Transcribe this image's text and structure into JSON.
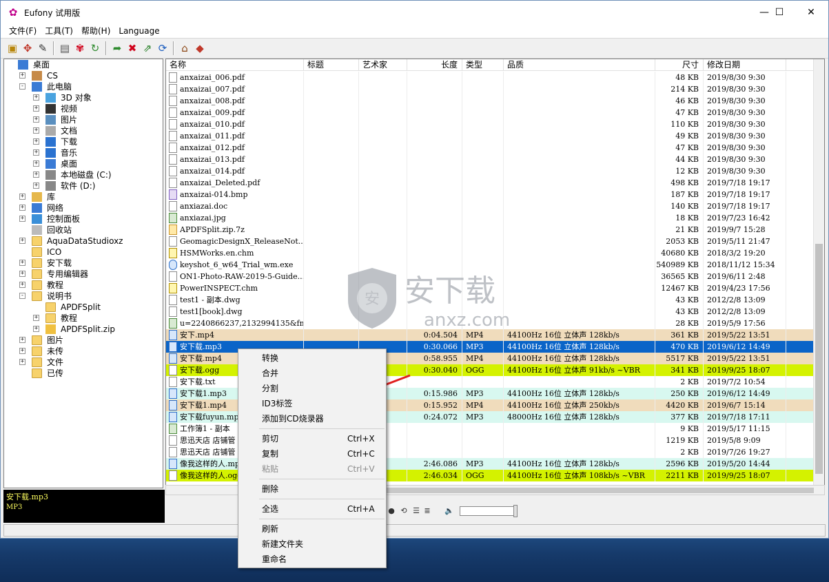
{
  "window": {
    "title": "Eufony 试用版",
    "minimize": "—",
    "maximize": "☐",
    "close": "✕"
  },
  "menu": [
    "文件(F)",
    "工具(T)",
    "帮助(H)",
    "Language"
  ],
  "toolbar_icons": [
    "open-folder-icon",
    "tag-icon",
    "edit-icon",
    "new-doc-icon",
    "flower-icon",
    "refresh-icon",
    "forward-icon",
    "cross-icon",
    "swap-icon",
    "sync-icon",
    "home-icon",
    "book-icon"
  ],
  "tree": [
    {
      "label": "桌面",
      "level": 0,
      "exp": "",
      "icon": "desktop"
    },
    {
      "label": "CS",
      "level": 1,
      "exp": "+",
      "icon": "user"
    },
    {
      "label": "此电脑",
      "level": 1,
      "exp": "-",
      "icon": "computer"
    },
    {
      "label": "3D 对象",
      "level": 2,
      "exp": "+",
      "icon": "3d"
    },
    {
      "label": "视频",
      "level": 2,
      "exp": "+",
      "icon": "video"
    },
    {
      "label": "图片",
      "level": 2,
      "exp": "+",
      "icon": "picture"
    },
    {
      "label": "文档",
      "level": 2,
      "exp": "+",
      "icon": "document"
    },
    {
      "label": "下载",
      "level": 2,
      "exp": "+",
      "icon": "download"
    },
    {
      "label": "音乐",
      "level": 2,
      "exp": "+",
      "icon": "music"
    },
    {
      "label": "桌面",
      "level": 2,
      "exp": "+",
      "icon": "desktop"
    },
    {
      "label": "本地磁盘 (C:)",
      "level": 2,
      "exp": "+",
      "icon": "disk"
    },
    {
      "label": "软件 (D:)",
      "level": 2,
      "exp": "+",
      "icon": "disk"
    },
    {
      "label": "库",
      "level": 1,
      "exp": "+",
      "icon": "library"
    },
    {
      "label": "网络",
      "level": 1,
      "exp": "+",
      "icon": "network"
    },
    {
      "label": "控制面板",
      "level": 1,
      "exp": "+",
      "icon": "control"
    },
    {
      "label": "回收站",
      "level": 1,
      "exp": "",
      "icon": "recycle"
    },
    {
      "label": "AquaDataStudioxz",
      "level": 1,
      "exp": "+",
      "icon": "folder"
    },
    {
      "label": "ICO",
      "level": 1,
      "exp": "",
      "icon": "folder"
    },
    {
      "label": "安下载",
      "level": 1,
      "exp": "+",
      "icon": "folder"
    },
    {
      "label": "专用编辑器",
      "level": 1,
      "exp": "+",
      "icon": "folder"
    },
    {
      "label": "教程",
      "level": 1,
      "exp": "+",
      "icon": "folder"
    },
    {
      "label": "说明书",
      "level": 1,
      "exp": "-",
      "icon": "folder"
    },
    {
      "label": "APDFSplit",
      "level": 2,
      "exp": "",
      "icon": "folder"
    },
    {
      "label": "教程",
      "level": 2,
      "exp": "+",
      "icon": "folder"
    },
    {
      "label": "APDFSplit.zip",
      "level": 2,
      "exp": "+",
      "icon": "zip"
    },
    {
      "label": "图片",
      "level": 1,
      "exp": "+",
      "icon": "folder"
    },
    {
      "label": "未传",
      "level": 1,
      "exp": "+",
      "icon": "folder"
    },
    {
      "label": "文件",
      "level": 1,
      "exp": "+",
      "icon": "folder"
    },
    {
      "label": "已传",
      "level": 1,
      "exp": "",
      "icon": "folder"
    }
  ],
  "columns": [
    "名称",
    "标题",
    "艺术家",
    "长度",
    "类型",
    "品质",
    "尺寸",
    "修改日期"
  ],
  "files": [
    {
      "name": "anxaizai_006.pdf",
      "title": "",
      "artist": "",
      "length": "",
      "type": "",
      "quality": "",
      "size": "48 KB",
      "date": "2019/8/30 9:30",
      "icon": "pdf",
      "bg": "#ffffff",
      "fg": "#000000"
    },
    {
      "name": "anxaizai_007.pdf",
      "title": "",
      "artist": "",
      "length": "",
      "type": "",
      "quality": "",
      "size": "214 KB",
      "date": "2019/8/30 9:30",
      "icon": "pdf",
      "bg": "#ffffff",
      "fg": "#000000"
    },
    {
      "name": "anxaizai_008.pdf",
      "title": "",
      "artist": "",
      "length": "",
      "type": "",
      "quality": "",
      "size": "46 KB",
      "date": "2019/8/30 9:30",
      "icon": "pdf",
      "bg": "#ffffff",
      "fg": "#000000"
    },
    {
      "name": "anxaizai_009.pdf",
      "title": "",
      "artist": "",
      "length": "",
      "type": "",
      "quality": "",
      "size": "47 KB",
      "date": "2019/8/30 9:30",
      "icon": "pdf",
      "bg": "#ffffff",
      "fg": "#000000"
    },
    {
      "name": "anxaizai_010.pdf",
      "title": "",
      "artist": "",
      "length": "",
      "type": "",
      "quality": "",
      "size": "110 KB",
      "date": "2019/8/30 9:30",
      "icon": "pdf",
      "bg": "#ffffff",
      "fg": "#000000"
    },
    {
      "name": "anxaizai_011.pdf",
      "title": "",
      "artist": "",
      "length": "",
      "type": "",
      "quality": "",
      "size": "49 KB",
      "date": "2019/8/30 9:30",
      "icon": "pdf",
      "bg": "#ffffff",
      "fg": "#000000"
    },
    {
      "name": "anxaizai_012.pdf",
      "title": "",
      "artist": "",
      "length": "",
      "type": "",
      "quality": "",
      "size": "47 KB",
      "date": "2019/8/30 9:30",
      "icon": "pdf",
      "bg": "#ffffff",
      "fg": "#000000"
    },
    {
      "name": "anxaizai_013.pdf",
      "title": "",
      "artist": "",
      "length": "",
      "type": "",
      "quality": "",
      "size": "44 KB",
      "date": "2019/8/30 9:30",
      "icon": "pdf",
      "bg": "#ffffff",
      "fg": "#000000"
    },
    {
      "name": "anxaizai_014.pdf",
      "title": "",
      "artist": "",
      "length": "",
      "type": "",
      "quality": "",
      "size": "12 KB",
      "date": "2019/8/30 9:30",
      "icon": "pdf",
      "bg": "#ffffff",
      "fg": "#000000"
    },
    {
      "name": "anxaizai_Deleted.pdf",
      "title": "",
      "artist": "",
      "length": "",
      "type": "",
      "quality": "",
      "size": "498 KB",
      "date": "2019/7/18 19:17",
      "icon": "pdf",
      "bg": "#ffffff",
      "fg": "#000000"
    },
    {
      "name": "anxaizai-014.bmp",
      "title": "",
      "artist": "",
      "length": "",
      "type": "",
      "quality": "",
      "size": "187 KB",
      "date": "2019/7/18 19:17",
      "icon": "bmp",
      "bg": "#ffffff",
      "fg": "#000000"
    },
    {
      "name": "anxiazai.doc",
      "title": "",
      "artist": "",
      "length": "",
      "type": "",
      "quality": "",
      "size": "140 KB",
      "date": "2019/7/18 19:17",
      "icon": "doc",
      "bg": "#ffffff",
      "fg": "#000000"
    },
    {
      "name": "anxiazai.jpg",
      "title": "",
      "artist": "",
      "length": "",
      "type": "",
      "quality": "",
      "size": "18 KB",
      "date": "2019/7/23 16:42",
      "icon": "img",
      "bg": "#ffffff",
      "fg": "#000000"
    },
    {
      "name": "APDFSplit.zip.7z",
      "title": "",
      "artist": "",
      "length": "",
      "type": "",
      "quality": "",
      "size": "21 KB",
      "date": "2019/9/7 15:28",
      "icon": "zip",
      "bg": "#ffffff",
      "fg": "#000000"
    },
    {
      "name": "GeomagicDesignX_ReleaseNot...",
      "title": "",
      "artist": "",
      "length": "",
      "type": "",
      "quality": "",
      "size": "2053 KB",
      "date": "2019/5/11 21:47",
      "icon": "pdf",
      "bg": "#ffffff",
      "fg": "#000000"
    },
    {
      "name": "HSMWorks.en.chm",
      "title": "",
      "artist": "",
      "length": "",
      "type": "",
      "quality": "",
      "size": "40680 KB",
      "date": "2018/3/2 19:20",
      "icon": "chm",
      "bg": "#ffffff",
      "fg": "#000000"
    },
    {
      "name": "keyshot_6_w64_Trial_wm.exe",
      "title": "",
      "artist": "",
      "length": "",
      "type": "",
      "quality": "",
      "size": "540989 KB",
      "date": "2018/11/12 15:34",
      "icon": "exe",
      "bg": "#ffffff",
      "fg": "#000000"
    },
    {
      "name": "ON1-Photo-RAW-2019-5-Guide...",
      "title": "",
      "artist": "",
      "length": "",
      "type": "",
      "quality": "",
      "size": "36565 KB",
      "date": "2019/6/11 2:48",
      "icon": "pdf",
      "bg": "#ffffff",
      "fg": "#000000"
    },
    {
      "name": "PowerINSPECT.chm",
      "title": "",
      "artist": "",
      "length": "",
      "type": "",
      "quality": "",
      "size": "12467 KB",
      "date": "2019/4/23 17:56",
      "icon": "chm",
      "bg": "#ffffff",
      "fg": "#000000"
    },
    {
      "name": "test1 - 副本.dwg",
      "title": "",
      "artist": "",
      "length": "",
      "type": "",
      "quality": "",
      "size": "43 KB",
      "date": "2012/2/8 13:09",
      "icon": "doc",
      "bg": "#ffffff",
      "fg": "#000000"
    },
    {
      "name": "test1[book].dwg",
      "title": "",
      "artist": "",
      "length": "",
      "type": "",
      "quality": "",
      "size": "43 KB",
      "date": "2012/2/8 13:09",
      "icon": "doc",
      "bg": "#ffffff",
      "fg": "#000000"
    },
    {
      "name": "u=2240866237,2132994135&fm...",
      "title": "",
      "artist": "",
      "length": "",
      "type": "",
      "quality": "",
      "size": "28 KB",
      "date": "2019/5/9 17:56",
      "icon": "img",
      "bg": "#ffffff",
      "fg": "#000000"
    },
    {
      "name": "安下.mp4",
      "title": "",
      "artist": "",
      "length": "0:04.504",
      "type": "MP4",
      "quality": "44100Hz 16位 立体声 128kb/s",
      "size": "361 KB",
      "date": "2019/5/22 13:51",
      "icon": "media",
      "bg": "#f0dcbc",
      "fg": "#000000"
    },
    {
      "name": "安下载.mp3",
      "title": "",
      "artist": "",
      "length": "0:30.066",
      "type": "MP3",
      "quality": "44100Hz 16位 立体声 128kb/s",
      "size": "470 KB",
      "date": "2019/6/12 14:49",
      "icon": "media",
      "bg": "#0a64c8",
      "fg": "#ffffff"
    },
    {
      "name": "安下载.mp4",
      "title": "",
      "artist": "",
      "length": "0:58.955",
      "type": "MP4",
      "quality": "44100Hz 16位 立体声 128kb/s",
      "size": "5517 KB",
      "date": "2019/5/22 13:51",
      "icon": "media",
      "bg": "#f0dcbc",
      "fg": "#000000"
    },
    {
      "name": "安下载.ogg",
      "title": "",
      "artist": "",
      "length": "0:30.040",
      "type": "OGG",
      "quality": "44100Hz 16位 立体声 91kb/s ~VBR",
      "size": "341 KB",
      "date": "2019/9/25 18:07",
      "icon": "doc",
      "bg": "#d4f200",
      "fg": "#000000"
    },
    {
      "name": "安下载.txt",
      "title": "",
      "artist": "",
      "length": "",
      "type": "",
      "quality": "",
      "size": "2 KB",
      "date": "2019/7/2 10:54",
      "icon": "doc",
      "bg": "#ffffff",
      "fg": "#000000"
    },
    {
      "name": "安下载1.mp3",
      "title": "",
      "artist": "",
      "length": "0:15.986",
      "type": "MP3",
      "quality": "44100Hz 16位 立体声 128kb/s",
      "size": "250 KB",
      "date": "2019/6/12 14:49",
      "icon": "media",
      "bg": "#d8f8f0",
      "fg": "#000000"
    },
    {
      "name": "安下载1.mp4",
      "title": "",
      "artist": "",
      "length": "0:15.952",
      "type": "MP4",
      "quality": "44100Hz 16位 立体声 250kb/s",
      "size": "4420 KB",
      "date": "2019/6/7 15:14",
      "icon": "media",
      "bg": "#f0dcbc",
      "fg": "#000000"
    },
    {
      "name": "安下载fuyun.mp3",
      "title": "",
      "artist": "",
      "length": "0:24.072",
      "type": "MP3",
      "quality": "48000Hz 16位 立体声 128kb/s",
      "size": "377 KB",
      "date": "2019/7/18 17:11",
      "icon": "media",
      "bg": "#d8f8f0",
      "fg": "#000000"
    },
    {
      "name": "工作簿1 - 副本",
      "title": "",
      "artist": "",
      "length": "",
      "type": "",
      "quality": "",
      "size": "9 KB",
      "date": "2019/5/17 11:15",
      "icon": "img",
      "bg": "#ffffff",
      "fg": "#000000"
    },
    {
      "name": "思迅天店 店铺管",
      "title": "",
      "artist": "",
      "length": "",
      "type": "",
      "quality": "",
      "size": "1219 KB",
      "date": "2019/5/8 9:09",
      "icon": "doc",
      "bg": "#ffffff",
      "fg": "#000000"
    },
    {
      "name": "思迅天店 店铺管",
      "title": "",
      "artist": "",
      "length": "",
      "type": "",
      "quality": "",
      "size": "2 KB",
      "date": "2019/7/26 19:27",
      "icon": "doc",
      "bg": "#ffffff",
      "fg": "#000000"
    },
    {
      "name": "像我这样的人.mp3",
      "title": "",
      "artist": "",
      "length": "2:46.086",
      "type": "MP3",
      "quality": "44100Hz 16位 立体声 128kb/s",
      "size": "2596 KB",
      "date": "2019/5/20 14:44",
      "icon": "media",
      "bg": "#d8f8f0",
      "fg": "#000000"
    },
    {
      "name": "像我这样的人.ogg",
      "title": "",
      "artist": "",
      "length": "2:46.034",
      "type": "OGG",
      "quality": "44100Hz 16位 立体声 108kb/s ~VBR",
      "size": "2211 KB",
      "date": "2019/9/25 18:07",
      "icon": "doc",
      "bg": "#d4f200",
      "fg": "#000000"
    }
  ],
  "info": {
    "name": "安下载.mp3",
    "type": "MP3"
  },
  "context_menu": [
    {
      "label": "转换",
      "shortcut": "",
      "disabled": false
    },
    {
      "label": "合并",
      "shortcut": "",
      "disabled": false
    },
    {
      "label": "分割",
      "shortcut": "",
      "disabled": false
    },
    {
      "label": "ID3标签",
      "shortcut": "",
      "disabled": false
    },
    {
      "label": "添加到CD烧录器",
      "shortcut": "",
      "disabled": false
    },
    {
      "sep": true
    },
    {
      "label": "剪切",
      "shortcut": "Ctrl+X",
      "disabled": false
    },
    {
      "label": "复制",
      "shortcut": "Ctrl+C",
      "disabled": false
    },
    {
      "label": "粘贴",
      "shortcut": "Ctrl+V",
      "disabled": true
    },
    {
      "sep": true
    },
    {
      "label": "删除",
      "shortcut": "",
      "disabled": false
    },
    {
      "sep": true
    },
    {
      "label": "全选",
      "shortcut": "Ctrl+A",
      "disabled": false
    },
    {
      "sep": true
    },
    {
      "label": "刷新",
      "shortcut": "",
      "disabled": false
    },
    {
      "label": "新建文件夹",
      "shortcut": "",
      "disabled": false
    },
    {
      "label": "重命名",
      "shortcut": "",
      "disabled": false
    }
  ],
  "watermark": {
    "brand": "安下载",
    "domain": "anxz.com"
  },
  "colors": {
    "selection": "#0a64c8",
    "video_row": "#f0dcbc",
    "audio_row": "#d8f8f0",
    "ogg_row": "#d4f200",
    "arrow": "#e0201f"
  }
}
